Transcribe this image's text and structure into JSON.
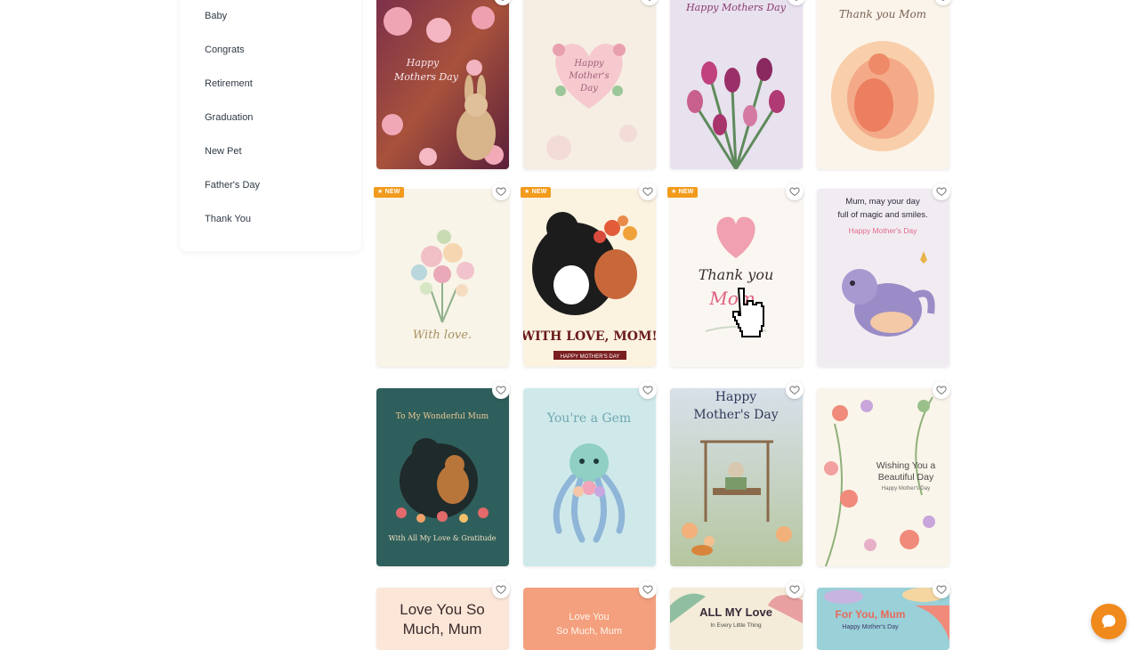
{
  "sidebar": {
    "items": [
      {
        "label": "Baby"
      },
      {
        "label": "Congrats"
      },
      {
        "label": "Retirement"
      },
      {
        "label": "Graduation"
      },
      {
        "label": "New Pet"
      },
      {
        "label": "Father's Day"
      },
      {
        "label": "Thank You"
      }
    ]
  },
  "badge_new": "NEW",
  "cards": [
    {
      "title_l1": "Happy",
      "title_l2": "Mothers Day"
    },
    {
      "title_l1": "Happy",
      "title_l2": "Mother's",
      "title_l3": "Day"
    },
    {
      "title": "Happy Mothers Day"
    },
    {
      "title": "Thank you Mom"
    },
    {
      "title": "With love."
    },
    {
      "title": "WITH LOVE, MOM!",
      "subtitle": "HAPPY MOTHER'S DAY"
    },
    {
      "title_l1": "Thank you",
      "title_l2": "Mom"
    },
    {
      "title_l1": "Mum, may your day",
      "title_l2": "full of magic and smiles.",
      "subtitle": "Happy Mother's Day"
    },
    {
      "title": "To My Wonderful Mum",
      "subtitle": "With All My Love & Gratitude"
    },
    {
      "title": "You're a Gem"
    },
    {
      "title_l1": "Happy",
      "title_l2": "Mother's Day"
    },
    {
      "title_l1": "Wishing You a",
      "title_l2": "Beautiful Day",
      "subtitle": "Happy Mother's Day"
    },
    {
      "title_l1": "Love You So",
      "title_l2": "Much, Mum"
    },
    {
      "title_l1": "Love You",
      "title_l2": "So Much, Mum"
    },
    {
      "title": "ALL MY Love",
      "subtitle": "In Every Little Thing"
    },
    {
      "title": "For You, Mum",
      "subtitle": "Happy Mother's Day"
    }
  ],
  "colors": {
    "accent": "#f08a1c",
    "badge": "#f29b1d",
    "sidebar_text": "#2f3a45"
  },
  "icons": {
    "favorite": "heart-outline-icon",
    "chat": "chat-bubble-icon",
    "cursor": "hand-pointer-icon"
  }
}
